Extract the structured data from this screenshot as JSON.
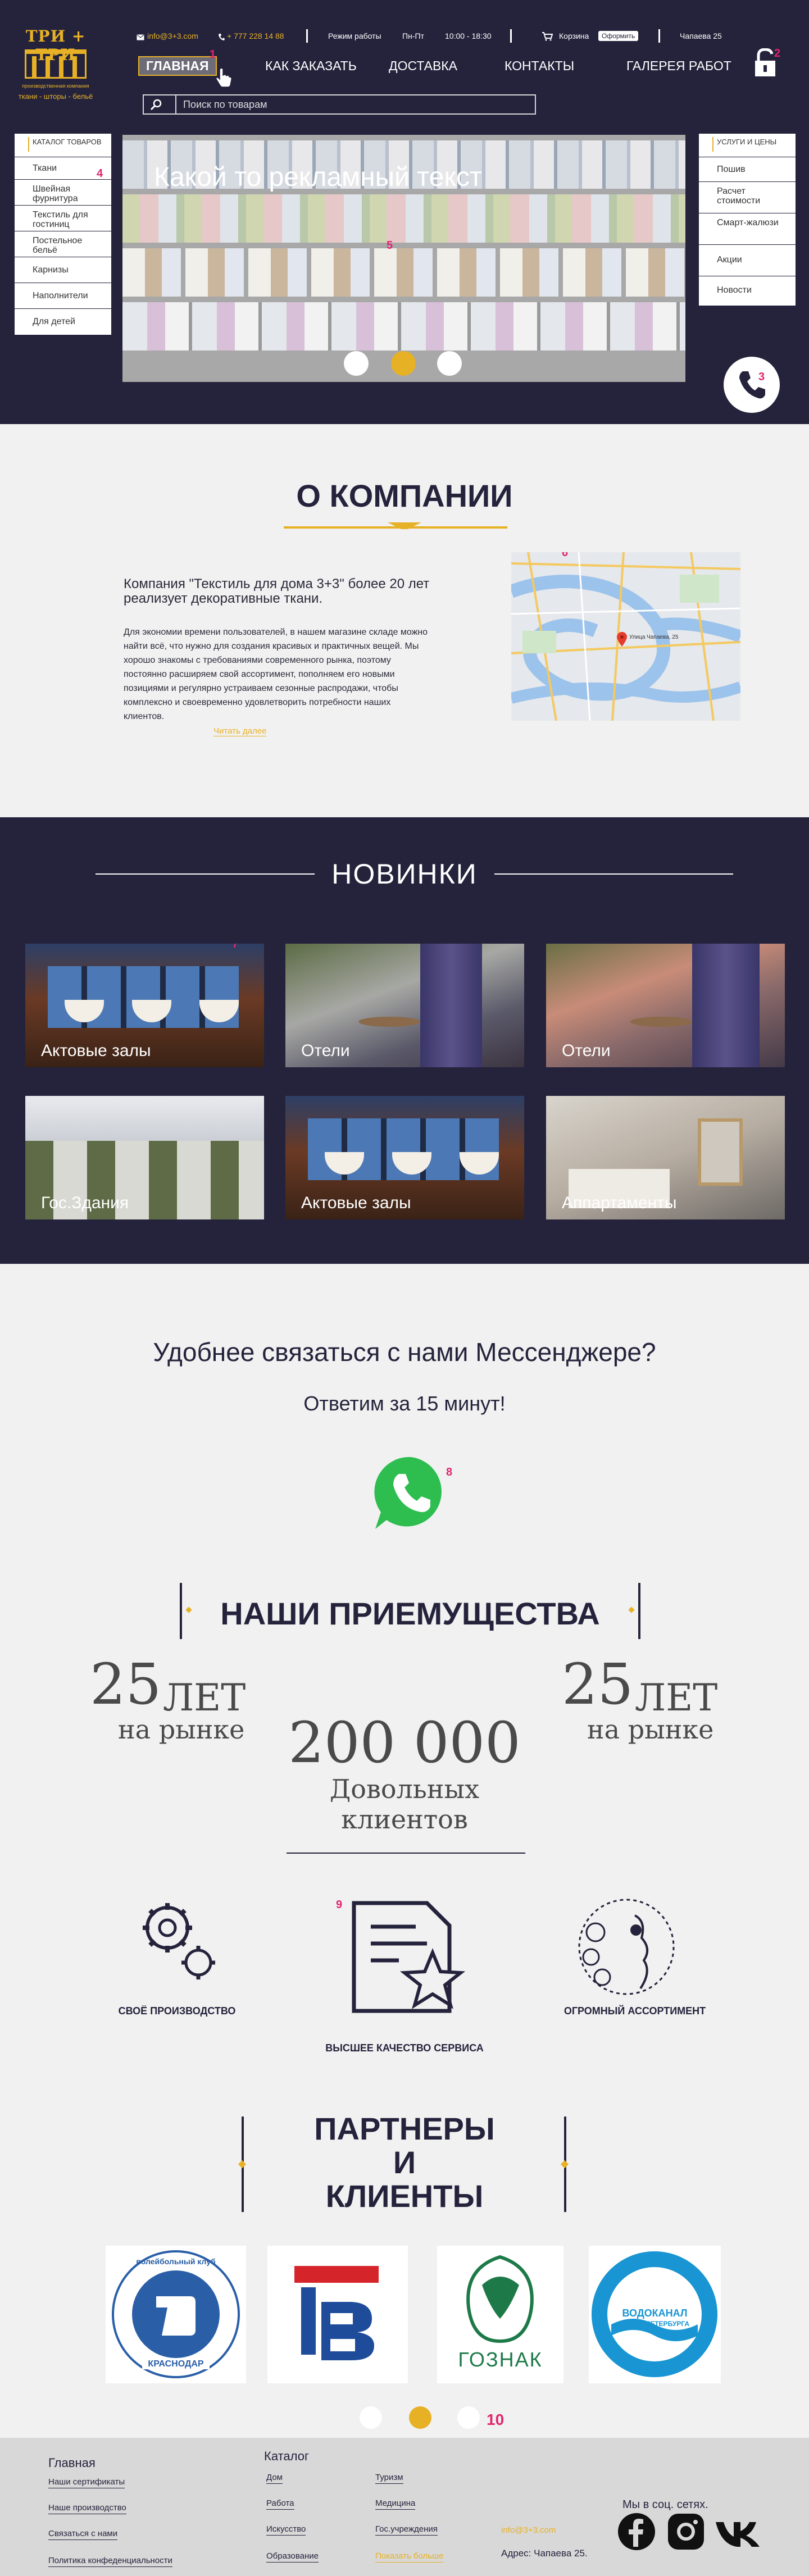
{
  "logo": {
    "title": "ТРИ + ТРИ",
    "sub1": "производственная компания",
    "sub2": "ткани - шторы - бельё"
  },
  "topbar": {
    "email": "info@3+3.com",
    "phone": "+ 777 228 14 88",
    "hours_label": "Режим работы",
    "days": "Пн-Пт",
    "hours": "10:00 - 18:30",
    "cart_label": "Корзина",
    "checkout_label": "Оформить",
    "address": "Чапаева 25"
  },
  "nav": {
    "items": [
      "ГЛАВНАЯ",
      "КАК ЗАКАЗАТЬ",
      "ДОСТАВКА",
      "КОНТАКТЫ",
      "ГАЛЕРЕЯ РАБОТ"
    ],
    "active_marker": "1",
    "lock_marker": "2"
  },
  "search": {
    "placeholder": "Поиск по товарам"
  },
  "catalog": {
    "items": [
      "КАТАЛОГ ТОВАРОВ",
      "Ткани",
      "Швейная фурнитура",
      "Текстиль для гостиниц",
      "Постельное бельё",
      "Карнизы",
      "Наполнители",
      "Для детей"
    ],
    "marker": "4"
  },
  "services": {
    "items": [
      "УСЛУГИ И ЦЕНЫ",
      "Пошив",
      "Расчет стоимости",
      "Смарт-жалюзи",
      "Акции",
      "Новости"
    ]
  },
  "slider": {
    "text": "Какой то рекламный текст",
    "marker": "5"
  },
  "phone_marker": "3",
  "about": {
    "title": "О КОМПАНИИ",
    "lead": "Компания \"Текстиль для дома 3+3\" более 20 лет реализует декоративные ткани.",
    "body": "Для экономии времени пользователей, в нашем магазине складе можно найти всё, что нужно для создания красивых и практичных вещей. Мы хорошо знакомы с требованиями современного рынка, поэтому постоянно расширяем свой ассортимент, пополняем его новыми позициями и регулярно устраиваем сезонные распродажи, чтобы комплексно и своевременно удовлетворить потребности наших клиентов.",
    "more": "Читать далее",
    "map_marker": "6",
    "map_label": "Улица Чапаева, 25"
  },
  "new": {
    "title": "НОВИНКИ",
    "marker": "7",
    "cards": [
      "Актовые залы",
      "Отели",
      "Отели",
      "Гос.Здания",
      "Актовые залы",
      "Аппартаменты"
    ]
  },
  "contact": {
    "title": "Удобнее связаться с нами  Мессенджере?",
    "subtitle": "Ответим за 15 минут!",
    "marker": "8"
  },
  "advantages": {
    "title": "НАШИ ПРИЕМУЩЕСТВА",
    "stats": [
      {
        "num": "25",
        "unit": "ЛЕТ",
        "caption": "на рынке"
      },
      {
        "num": "200 000",
        "caption": "Довольных клиентов"
      },
      {
        "num": "25",
        "unit": "ЛЕТ",
        "caption": "на рынке"
      }
    ],
    "features": [
      "СВОЁ ПРОИЗВОДСТВО",
      "ВЫСШЕЕ КАЧЕСТВО СЕРВИСА",
      "ОГРОМНЫЙ АССОРТИМЕНТ"
    ],
    "marker": "9"
  },
  "partners": {
    "title_1": "ПАРТНЕРЫ",
    "title_2": "И",
    "title_3": "КЛИЕНТЫ",
    "marker": "10",
    "logos": [
      {
        "name": "Динамо",
        "ring": "волейбольный клуб",
        "city": "КРАСНОДАР"
      },
      {
        "name": "ГВ"
      },
      {
        "name": "ГОЗНАК"
      },
      {
        "name": "ВОДОКАНАЛ",
        "city": "САНКТ-ПЕТЕРБУРГА"
      }
    ]
  },
  "footer": {
    "col1_title": "Главная",
    "col1": [
      "Наши сертификаты",
      "Наше производство",
      "Связаться с нами",
      "Политика конфеденциальности"
    ],
    "col2_title": "Каталог",
    "col2": [
      "Дом",
      "Работа",
      "Искусство",
      "Образование"
    ],
    "col3": [
      "Туризм",
      "Медицина",
      "Гос.учреждения",
      "Показать больше"
    ],
    "email": "info@3+3.com",
    "address": "Адрес: Чапаева 25.",
    "social_label": "Мы в соц. сетях."
  },
  "colors": {
    "navy": "#25233c",
    "gold": "#e7b126",
    "marker": "#e2256e",
    "whatsapp": "#2ebd4f"
  }
}
